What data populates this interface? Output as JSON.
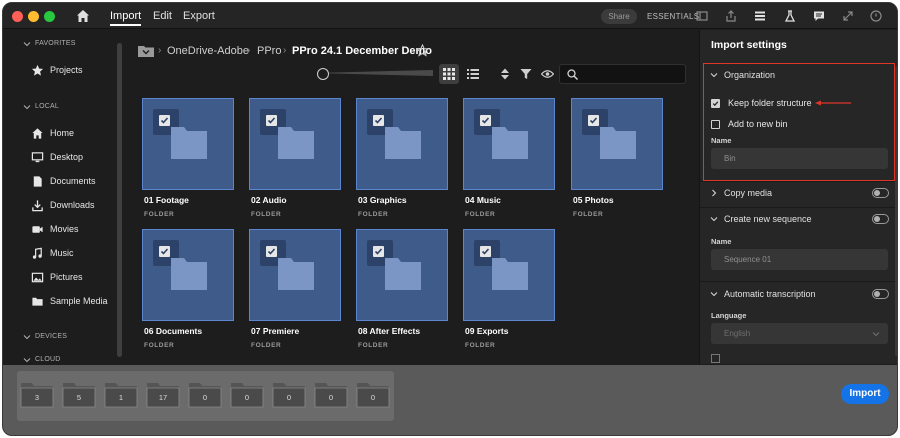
{
  "titlebar": {
    "menu": [
      "Import",
      "Edit",
      "Export"
    ],
    "share_label": "Share",
    "workspace_label": "ESSENTIALS"
  },
  "sidebar": {
    "sections": {
      "favorites": "FAVORITES",
      "local": "LOCAL",
      "devices": "DEVICES",
      "cloud": "CLOUD"
    },
    "favorites": [
      {
        "label": "Projects",
        "icon": "star-icon"
      }
    ],
    "local": [
      {
        "label": "Home",
        "icon": "home-icon"
      },
      {
        "label": "Desktop",
        "icon": "monitor-icon"
      },
      {
        "label": "Documents",
        "icon": "document-icon"
      },
      {
        "label": "Downloads",
        "icon": "download-icon"
      },
      {
        "label": "Movies",
        "icon": "video-icon"
      },
      {
        "label": "Music",
        "icon": "music-note-icon"
      },
      {
        "label": "Pictures",
        "icon": "image-icon"
      },
      {
        "label": "Sample Media",
        "icon": "folder-icon"
      }
    ]
  },
  "breadcrumb": [
    "OneDrive-Adobe",
    "PPro",
    "PPro 24.1 December Demo"
  ],
  "search": {
    "placeholder": ""
  },
  "folders": [
    {
      "name": "01 Footage",
      "kind": "FOLDER",
      "checked": true
    },
    {
      "name": "02 Audio",
      "kind": "FOLDER",
      "checked": true
    },
    {
      "name": "03 Graphics",
      "kind": "FOLDER",
      "checked": true
    },
    {
      "name": "04 Music",
      "kind": "FOLDER",
      "checked": true
    },
    {
      "name": "05 Photos",
      "kind": "FOLDER",
      "checked": true
    },
    {
      "name": "06 Documents",
      "kind": "FOLDER",
      "checked": true
    },
    {
      "name": "07 Premiere",
      "kind": "FOLDER",
      "checked": true
    },
    {
      "name": "08 After Effects",
      "kind": "FOLDER",
      "checked": true
    },
    {
      "name": "09 Exports",
      "kind": "FOLDER",
      "checked": true
    }
  ],
  "import_settings": {
    "title": "Import settings",
    "organization": {
      "label": "Organization",
      "keep_folder_structure": {
        "label": "Keep folder structure",
        "checked": true
      },
      "add_to_new_bin": {
        "label": "Add to new bin",
        "checked": false
      },
      "name_label": "Name",
      "name_placeholder": "Bin"
    },
    "copy_media": {
      "label": "Copy media",
      "enabled": false
    },
    "create_new_sequence": {
      "label": "Create new sequence",
      "enabled": false,
      "name_label": "Name",
      "name_placeholder": "Sequence 01"
    },
    "automatic_transcription": {
      "label": "Automatic transcription",
      "enabled": false,
      "language_label": "Language",
      "language_value": "English"
    }
  },
  "tray_counts": [
    "3",
    "5",
    "1",
    "17",
    "0",
    "0",
    "0",
    "0",
    "0"
  ],
  "import_button_label": "Import",
  "colors": {
    "accent": "#1473e6",
    "tile": "#3f5b8a",
    "tile_border": "#5b86cf",
    "highlight": "#e0352b"
  }
}
